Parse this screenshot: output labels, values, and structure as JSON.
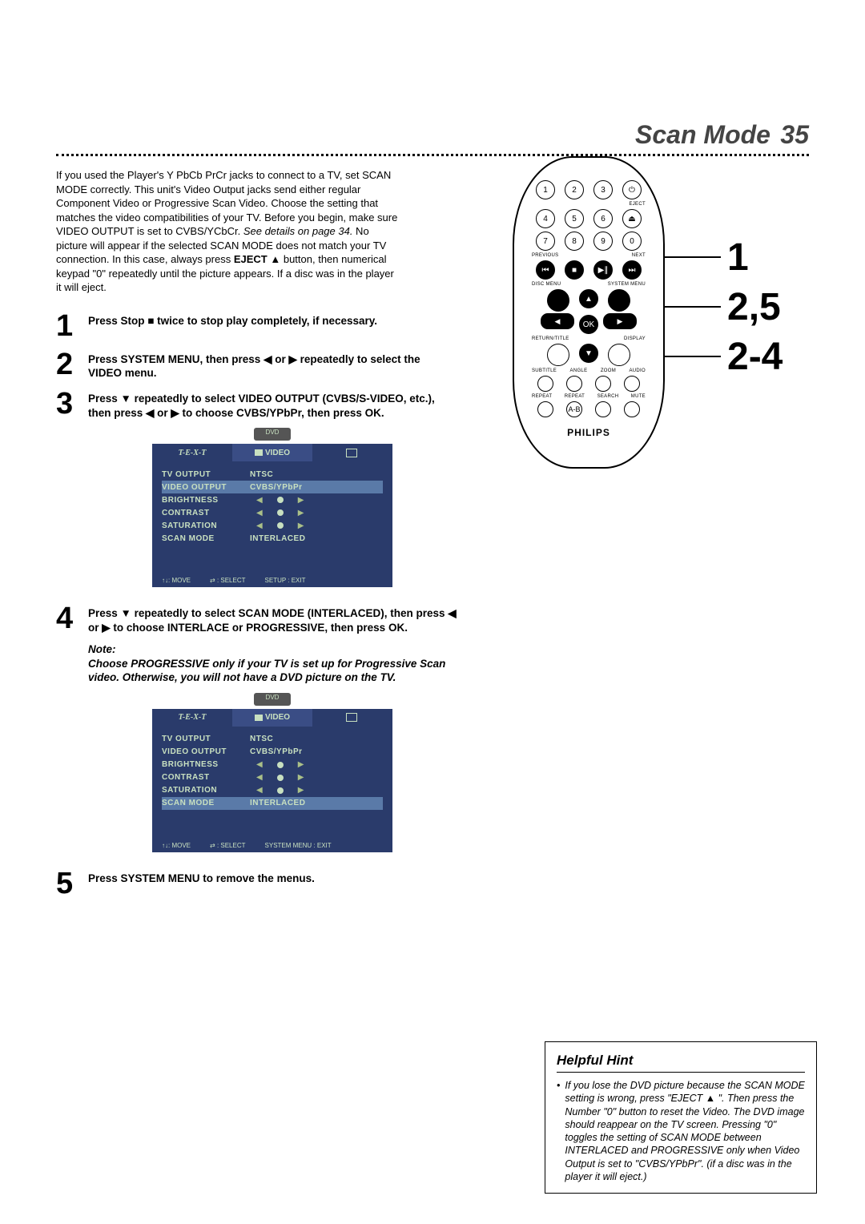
{
  "header": {
    "title": "Scan Mode",
    "page": "35"
  },
  "intro": {
    "p1": "If you used the Player's Y PbCb PrCr jacks to connect to a TV, set SCAN MODE correctly. This unit's Video Output jacks send either regular Component Video or Progressive Scan Video. Choose the setting that matches the video compatibilities of your TV. Before you begin, make sure VIDEO OUTPUT is set to CVBS/YCbCr. ",
    "italic": "See details on page 34.",
    "p1b": " No picture will appear if the selected SCAN MODE does not match your TV connection. In this case, always press ",
    "bold1": "EJECT ▲",
    "p1c": " button, then numerical keypad \"0\" repeatedly until the picture appears. If a disc was in the player it will eject."
  },
  "steps": {
    "s1": "Press Stop ■ twice to stop play completely, if necessary.",
    "s2": "Press SYSTEM MENU, then press ◀ or ▶ repeatedly to select the VIDEO menu.",
    "s3": "Press ▼ repeatedly to select VIDEO OUTPUT (CVBS/S-VIDEO, etc.), then press ◀ or ▶ to choose CVBS/YPbPr, then press OK.",
    "s4": "Press ▼ repeatedly to select SCAN MODE (INTERLACED), then press ◀ or ▶ to choose INTERLACE or PROGRESSIVE, then press OK.",
    "note_label": "Note:",
    "note": "Choose PROGRESSIVE only if your TV is set up for Progressive Scan video. Otherwise, you will not have a DVD picture on the TV.",
    "s5": "Press SYSTEM MENU to remove the menus."
  },
  "menu": {
    "dvd_tag": "DVD",
    "tab_active": "VIDEO",
    "rows": {
      "tv_output": {
        "k": "TV OUTPUT",
        "v": "NTSC"
      },
      "video_output": {
        "k": "VIDEO OUTPUT",
        "v": "CVBS/YPbPr"
      },
      "brightness": {
        "k": "BRIGHTNESS"
      },
      "contrast": {
        "k": "CONTRAST"
      },
      "saturation": {
        "k": "SATURATION"
      },
      "scan_mode": {
        "k": "SCAN MODE",
        "v": "INTERLACED"
      }
    },
    "footer1": {
      "move": "↑↓: MOVE",
      "select": "⇄ : SELECT",
      "exit": "SETUP : EXIT"
    },
    "footer2": {
      "move": "↑↓: MOVE",
      "select": "⇄ : SELECT",
      "exit": "SYSTEM MENU : EXIT"
    }
  },
  "remote": {
    "labels": {
      "eject": "EJECT",
      "previous": "PREVIOUS",
      "next": "NEXT",
      "disc_menu": "DISC MENU",
      "system_menu": "SYSTEM MENU",
      "return": "RETURN/TITLE",
      "display": "DISPLAY",
      "subtitle": "SUBTITLE",
      "angle": "ANGLE",
      "zoom": "ZOOM",
      "audio": "AUDIO",
      "repeat": "REPEAT",
      "repeat_ab": "REPEAT",
      "search": "SEARCH",
      "mute": "MUTE",
      "ab": "A-B",
      "ok": "OK",
      "brand": "PHILIPS",
      "power": "⏻",
      "ej": "⏏"
    },
    "nums": {
      "1": "1",
      "2": "2",
      "3": "3",
      "4": "4",
      "5": "5",
      "6": "6",
      "7": "7",
      "8": "8",
      "9": "9",
      "0": "0"
    }
  },
  "callouts": {
    "c1": "1",
    "c2": "2,5",
    "c3": "2-4"
  },
  "hint": {
    "title": "Helpful Hint",
    "body": "If you lose the DVD picture because the SCAN MODE setting is wrong, press \"EJECT ▲ \". Then press the Number \"0\" button to reset the Video. The DVD image should reappear on the TV screen. Pressing \"0\" toggles the setting of SCAN MODE between INTERLACED and PROGRESSIVE only when Video Output is set to \"CVBS/YPbPr\". (if a disc was in the player it will eject.)"
  }
}
